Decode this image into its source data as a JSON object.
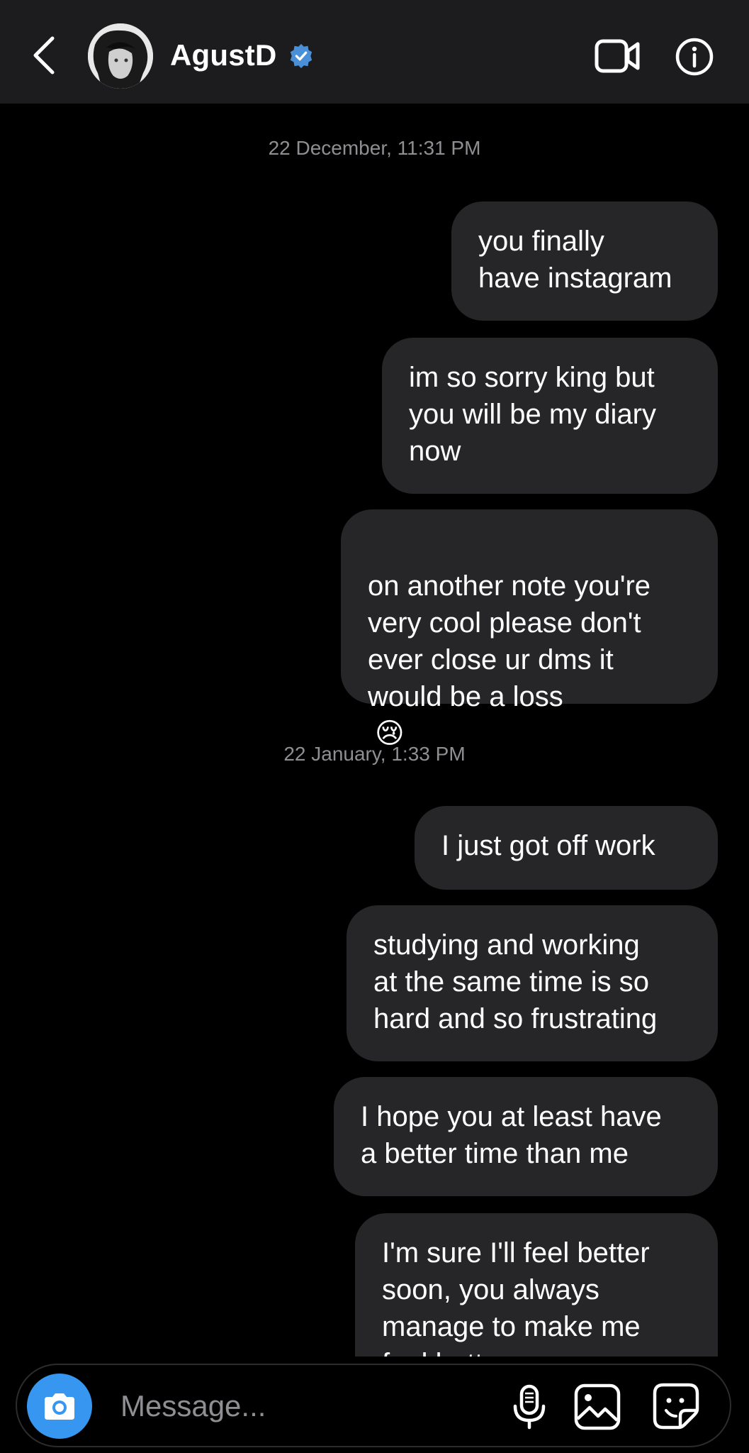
{
  "header": {
    "name": "AgustD",
    "verified": true,
    "icons": {
      "back": "chevron-left-icon",
      "video": "video-camera-icon",
      "info": "info-icon",
      "verified": "verified-badge-icon"
    }
  },
  "thread": {
    "groups": [
      {
        "date": "22 December, 11:31 PM",
        "messages": [
          "you finally\nhave instagram",
          "im so sorry king but\nyou will be my diary\nnow",
          "on another note you're\nvery cool please don't\never close ur dms it\nwould be a loss"
        ]
      },
      {
        "date": "22 January, 1:33 PM",
        "messages": [
          "I just got off work",
          "studying and working\nat the same time is so\nhard and so frustrating",
          "I hope you at least have\na better time than me",
          "I'm sure I'll feel better\nsoon, you always\nmanage to make me\nfeel better"
        ]
      }
    ],
    "emoji": "😢"
  },
  "composer": {
    "placeholder": "Message...",
    "icons": {
      "camera": "camera-icon",
      "mic": "microphone-icon",
      "gallery": "image-gallery-icon",
      "sticker": "sticker-icon"
    }
  },
  "colors": {
    "background": "#000000",
    "header": "#1c1c1e",
    "bubble": "#262628",
    "accent": "#3797f0",
    "verified": "#4a90d9",
    "timestamp": "#8e8e93"
  }
}
